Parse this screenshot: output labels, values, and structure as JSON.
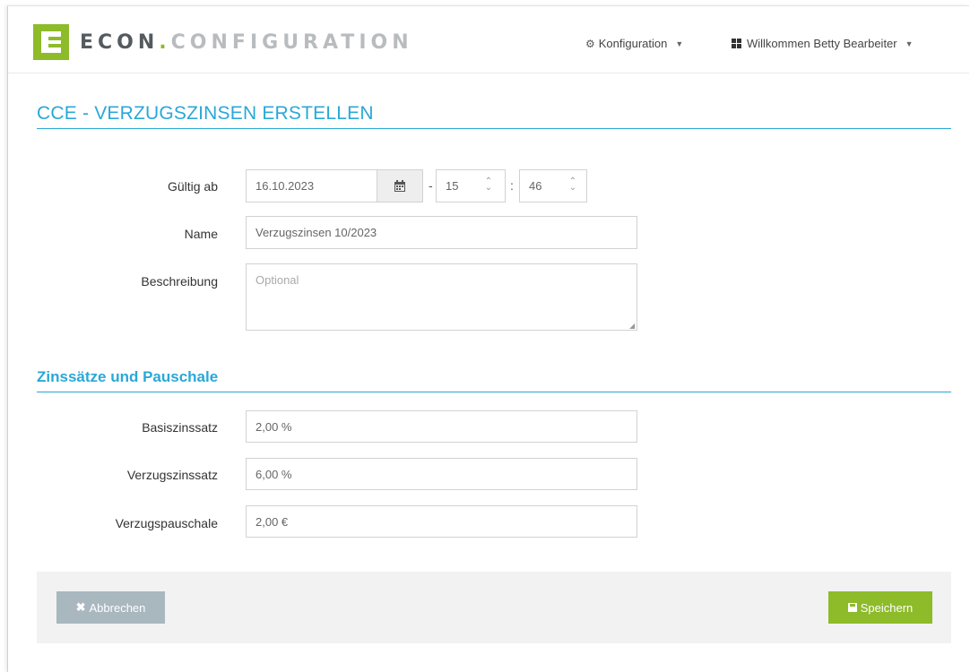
{
  "header": {
    "brand_main": "ECON",
    "brand_dot": ".",
    "brand_sub": "CONFIGURATION",
    "menu_config": "Konfiguration",
    "menu_user": "Willkommen Betty Bearbeiter"
  },
  "page": {
    "title": "CCE - VERZUGSZINSEN ERSTELLEN"
  },
  "form": {
    "valid_from_label": "Gültig ab",
    "date_value": "16.10.2023",
    "date_sep": "-",
    "hour_value": "15",
    "time_sep": ":",
    "minute_value": "46",
    "name_label": "Name",
    "name_value": "Verzugszinsen 10/2023",
    "description_label": "Beschreibung",
    "description_placeholder": "Optional"
  },
  "rates": {
    "section_title": "Zinssätze und Pauschale",
    "base_label": "Basiszinssatz",
    "base_value": "2,00 %",
    "default_label": "Verzugszinssatz",
    "default_value": "6,00 %",
    "flat_label": "Verzugspauschale",
    "flat_value": "2,00 €"
  },
  "footer": {
    "cancel_label": "Abbrechen",
    "save_label": "Speichern"
  },
  "colors": {
    "accent_blue": "#29a8d8",
    "brand_green": "#8dbb2a",
    "cancel_grey": "#a9b7bf"
  },
  "icons": [
    "logo-e-icon",
    "gear-icon",
    "caret-down-icon",
    "grid-icon",
    "calendar-icon",
    "spinner-icon",
    "times-icon",
    "floppy-icon",
    "resize-icon"
  ]
}
